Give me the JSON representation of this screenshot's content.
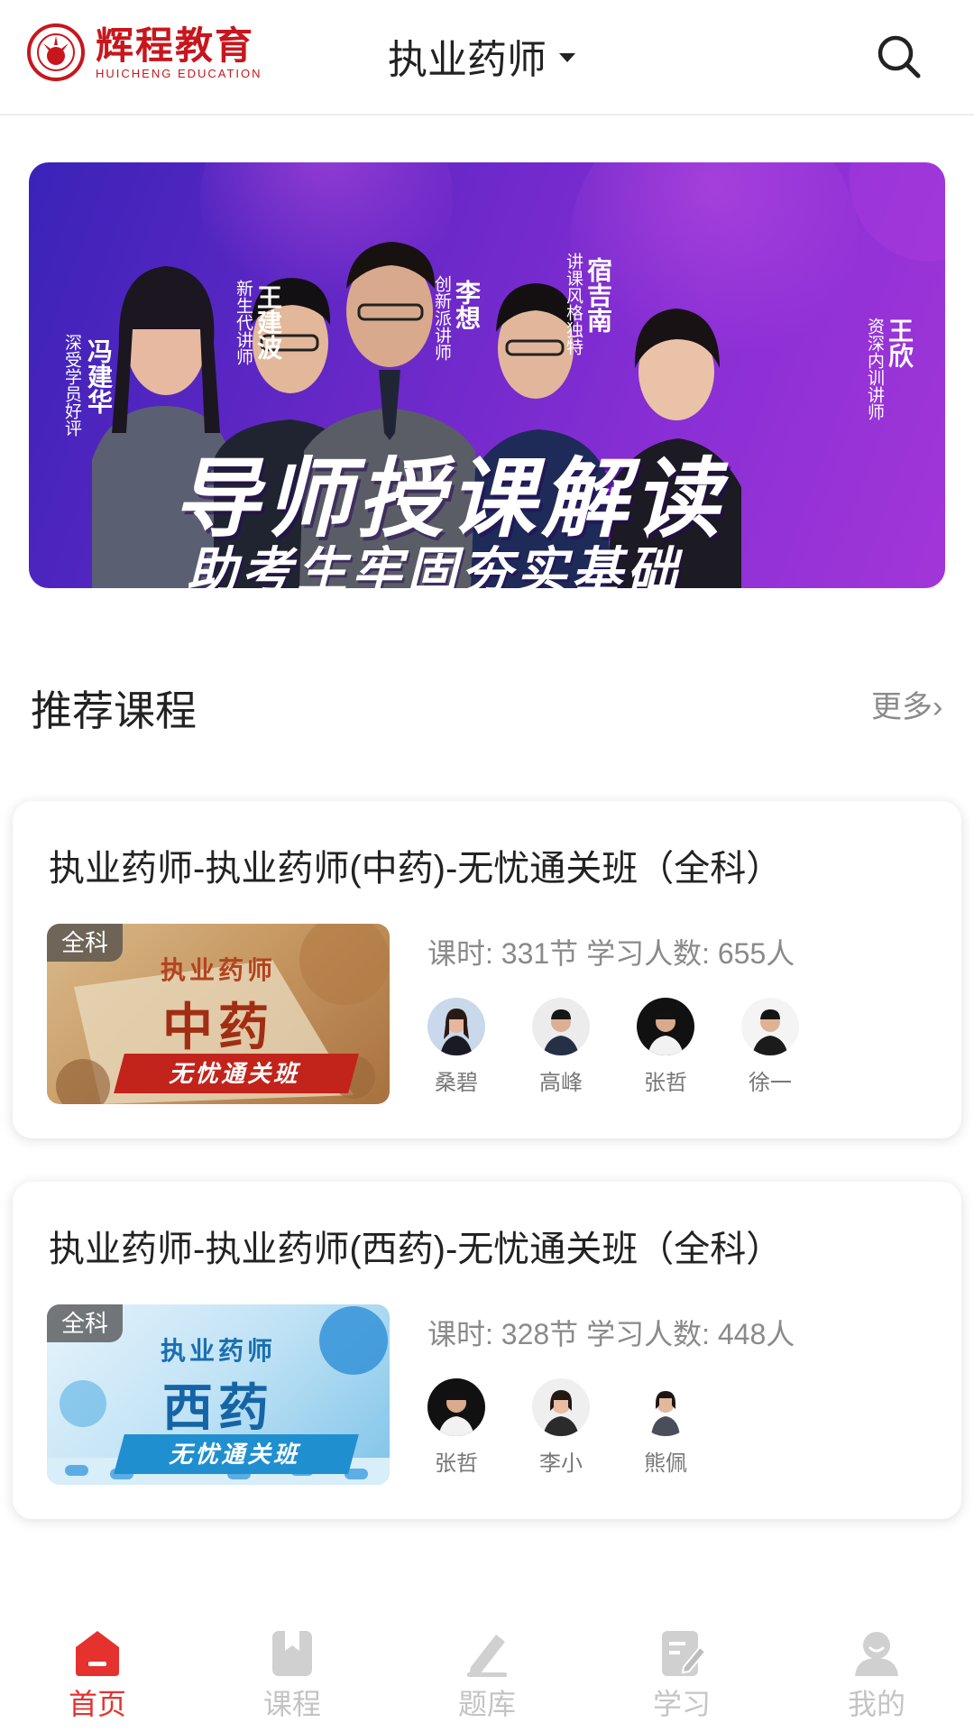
{
  "header": {
    "logo_cn": "辉程教育",
    "logo_en": "HUICHENG EDUCATION",
    "exam_selector": "执业药师"
  },
  "banner": {
    "headline": "导师授课解读",
    "subline": "助考生牢固夯实基础",
    "teachers": [
      {
        "name": "冯建华",
        "desc": "深受学员好评"
      },
      {
        "name": "王建波",
        "desc": "新生代讲师"
      },
      {
        "name": "李想",
        "desc": "创新派讲师"
      },
      {
        "name": "宿吉南",
        "desc": "讲课风格独特"
      },
      {
        "name": "王欣",
        "desc": "资深内训讲师"
      }
    ]
  },
  "section": {
    "title": "推荐课程",
    "more": "更多›"
  },
  "courses": [
    {
      "title": "执业药师-执业药师(中药)-无忧通关班（全科）",
      "badge": "全科",
      "thumb_small": "执业药师",
      "thumb_big": "中药",
      "thumb_ribbon": "无忧通关班",
      "stats": "课时: 331节  学习人数: 655人",
      "teachers": [
        "桑碧",
        "高峰",
        "张哲",
        "徐一"
      ]
    },
    {
      "title": "执业药师-执业药师(西药)-无忧通关班（全科）",
      "badge": "全科",
      "thumb_small": "执业药师",
      "thumb_big": "西药",
      "thumb_ribbon": "无忧通关班",
      "stats": "课时: 328节  学习人数: 448人",
      "teachers": [
        "张哲",
        "李小",
        "熊佩"
      ]
    }
  ],
  "tabbar": {
    "tabs": [
      {
        "label": "首页",
        "icon": "home-icon",
        "active": true
      },
      {
        "label": "课程",
        "icon": "bookmark-icon",
        "active": false
      },
      {
        "label": "题库",
        "icon": "pencil-icon",
        "active": false
      },
      {
        "label": "学习",
        "icon": "edit-note-icon",
        "active": false
      },
      {
        "label": "我的",
        "icon": "user-icon",
        "active": false
      }
    ]
  },
  "colors": {
    "brand_red": "#c8161d",
    "active_tab": "#e5322e",
    "inactive_tab": "#c4c4c4",
    "banner_purple": "#6a28c8"
  }
}
